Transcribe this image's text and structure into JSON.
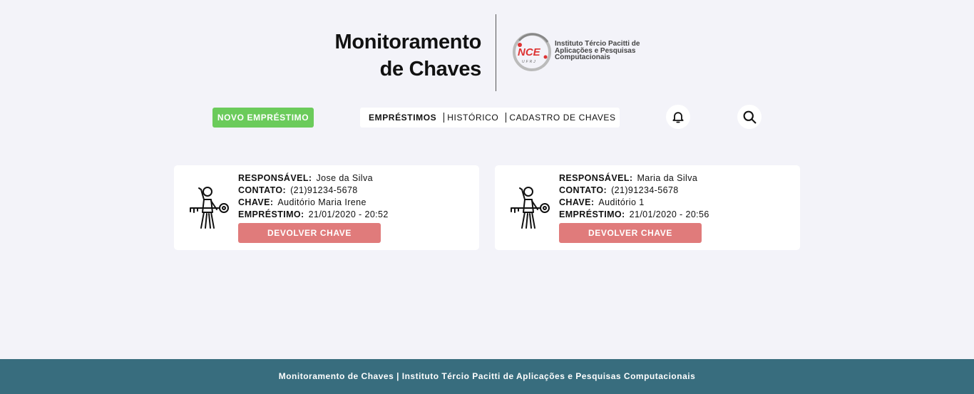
{
  "header": {
    "title_line1": "Monitoramento",
    "title_line2": "de Chaves",
    "logo_text_line1": "Instituto Tércio Pacitti de",
    "logo_text_line2": "Aplicações e Pesquisas",
    "logo_text_line3": "Computacionais",
    "logo_mark_text": "NCE",
    "logo_mark_sub": "UFRJ"
  },
  "toolbar": {
    "new_loan_label": "NOVO EMPRÉSTIMO",
    "nav": [
      {
        "label": "EMPRÉSTIMOS",
        "active": true
      },
      {
        "label": "HISTÓRICO",
        "active": false
      },
      {
        "label": "CADASTRO DE CHAVES",
        "active": false
      }
    ],
    "notifications_icon": "bell-icon",
    "search_icon": "search-icon"
  },
  "labels": {
    "responsible": "RESPONSÁVEL:",
    "contact": "CONTATO:",
    "key": "CHAVE:",
    "loan": "EMPRÉSTIMO:",
    "return_button": "DEVOLVER CHAVE"
  },
  "loans": [
    {
      "responsible": "Jose da Silva",
      "contact": "(21)91234-5678",
      "key": "Auditório Maria Irene",
      "loan_date": "21/01/2020 - 20:52"
    },
    {
      "responsible": "Maria da Silva",
      "contact": "(21)91234-5678",
      "key": "Auditório 1",
      "loan_date": "21/01/2020 - 20:56"
    }
  ],
  "footer": {
    "text": "Monitoramento de Chaves | Instituto Tércio Pacitti de Aplicações e Pesquisas Computacionais"
  },
  "colors": {
    "background": "#f3f3f9",
    "new_button": "#6bcb5b",
    "return_button": "#e07b7b",
    "footer": "#386d7e",
    "logo_accent": "#d33"
  }
}
